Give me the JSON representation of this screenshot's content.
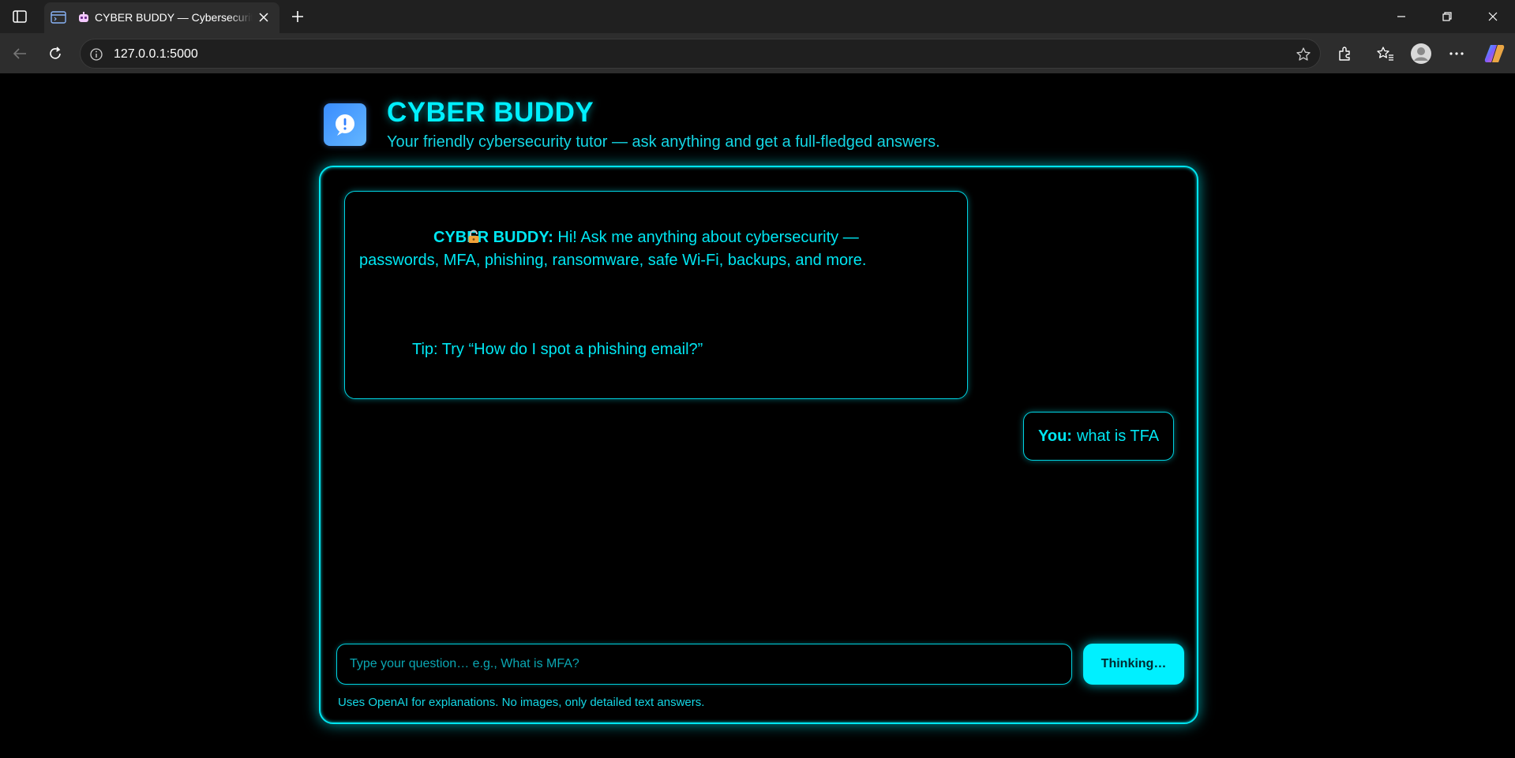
{
  "browser": {
    "tab_title": "CYBER BUDDY — Cybersecurity Tutor",
    "url": "127.0.0.1:5000",
    "icons": [
      "sidebar-icon",
      "workspace-icon",
      "favicon",
      "close-icon",
      "plus-icon",
      "minimize-icon",
      "restore-icon",
      "window-close-icon",
      "back-icon",
      "refresh-icon",
      "info-icon",
      "star-icon",
      "extensions-icon",
      "favorites-icon",
      "profile-icon",
      "more-icon",
      "copilot-icon"
    ]
  },
  "header": {
    "title": "CYBER BUDDY",
    "subtitle": "Your friendly cybersecurity tutor — ask anything and get a full-fledged answers."
  },
  "chat": {
    "bot": {
      "name": "CYBER BUDDY:",
      "text": "Hi! Ask me anything about cybersecurity — passwords, MFA, phishing, ransomware, safe Wi-Fi, backups, and more.",
      "tip": "Tip: Try “How do I spot a phishing email?”"
    },
    "user": {
      "name": "You:",
      "text": "what is TFA"
    }
  },
  "composer": {
    "placeholder": "Type your question… e.g., What is MFA?",
    "button_label": "Thinking…",
    "footnote": "Uses OpenAI for explanations. No images, only detailed text answers."
  },
  "colors": {
    "accent": "#00f0ff",
    "text": "#00e6f2",
    "background": "#000000",
    "logo": "#3a8dff"
  }
}
